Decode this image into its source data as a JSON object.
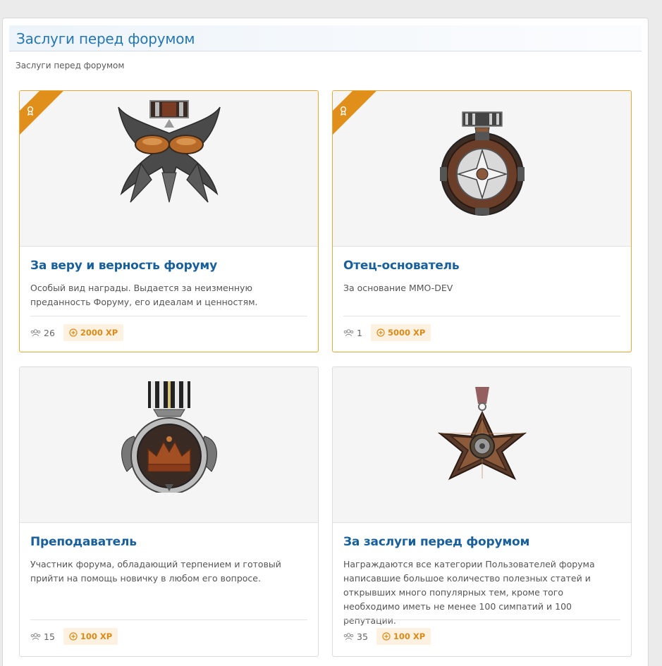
{
  "block": {
    "title": "Заслуги перед форумом",
    "description": "Заслуги перед форумом"
  },
  "colors": {
    "accent": "#2577b1",
    "earned_border": "#e5a93a",
    "ribbon": "#e08f1b",
    "xp_text": "#de8a17",
    "xp_bg": "#fdf1e1"
  },
  "awards": [
    {
      "title": "За веру и верность форуму",
      "description": "Особый вид награды. Выдается за неизменную преданность Форуму, его идеалам и ценностям.",
      "recipients": "26",
      "xp": "2000 XP",
      "earned": true,
      "icon": "winged-medal-icon"
    },
    {
      "title": "Отец-основатель",
      "description": "За основание MMO-DEV",
      "recipients": "1",
      "xp": "5000 XP",
      "earned": true,
      "icon": "star-cross-medal-icon"
    },
    {
      "title": "Преподаватель",
      "description": "Участник форума, обладающий терпением и готовый прийти на помощь новичку в любом его вопросе.",
      "recipients": "15",
      "xp": "100 XP",
      "earned": false,
      "icon": "crown-medal-icon"
    },
    {
      "title": "За заслуги перед форумом",
      "description": "Награждаются все категории Пользователей форума написавшие большое количество полезных статей и открывших много популярных тем, кроме того необходимо иметь не менее 100 симпатий и 100 репутации.",
      "recipients": "35",
      "xp": "100 XP",
      "earned": false,
      "icon": "bronze-cross-medal-icon"
    }
  ]
}
